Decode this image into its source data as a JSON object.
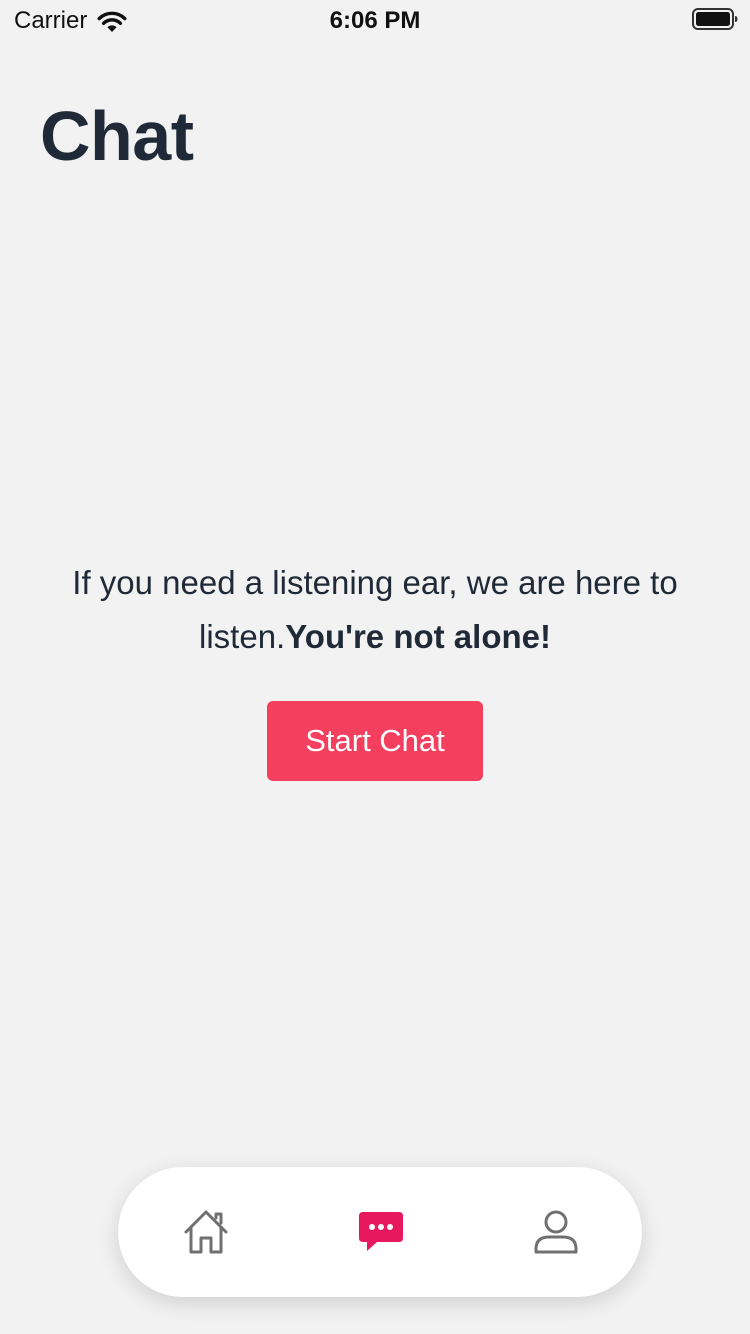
{
  "status_bar": {
    "carrier": "Carrier",
    "time": "6:06 PM"
  },
  "header": {
    "title": "Chat"
  },
  "main": {
    "message_text": "If you need a listening ear, we are here to listen.",
    "message_emphasis": "You're not alone!",
    "start_chat_label": "Start Chat"
  },
  "bottom_nav": {
    "items": [
      {
        "icon": "home-icon",
        "active": false
      },
      {
        "icon": "chat-bubble-icon",
        "active": true
      },
      {
        "icon": "user-icon",
        "active": false
      }
    ]
  },
  "colors": {
    "accent": "#f43f5e",
    "active_nav": "#e8185f",
    "inactive_nav": "#707070",
    "background": "#f2f2f2",
    "text": "#1f2937"
  }
}
